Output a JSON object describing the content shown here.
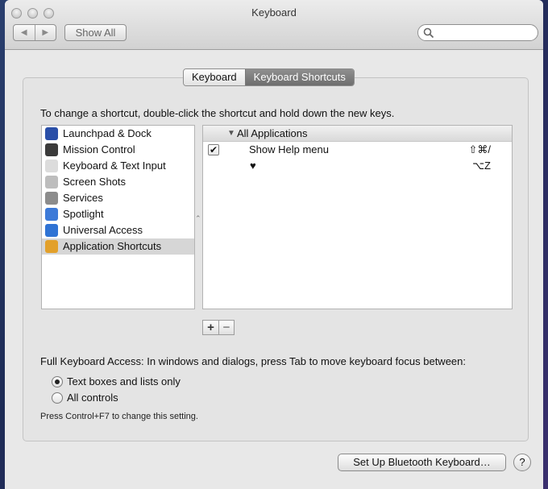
{
  "window": {
    "title": "Keyboard"
  },
  "toolbar": {
    "back_icon": "◀",
    "forward_icon": "▶",
    "show_all_label": "Show All",
    "search_value": "",
    "search_placeholder": ""
  },
  "tabs": [
    {
      "label": "Keyboard",
      "active": false
    },
    {
      "label": "Keyboard Shortcuts",
      "active": true
    }
  ],
  "instructions": "To change a shortcut, double-click the shortcut and hold down the new keys.",
  "categories": [
    {
      "label": "Launchpad & Dock",
      "icon": "launchpad-dock-icon",
      "color": "#2a4fa8",
      "selected": false
    },
    {
      "label": "Mission Control",
      "icon": "mission-control-icon",
      "color": "#3b3b3b",
      "selected": false
    },
    {
      "label": "Keyboard & Text Input",
      "icon": "keyboard-icon",
      "color": "#dcdcdc",
      "selected": false
    },
    {
      "label": "Screen Shots",
      "icon": "screenshot-icon",
      "color": "#bdbdbd",
      "selected": false
    },
    {
      "label": "Services",
      "icon": "gear-icon",
      "color": "#8c8c8c",
      "selected": false
    },
    {
      "label": "Spotlight",
      "icon": "spotlight-icon",
      "color": "#3d7ad8",
      "selected": false
    },
    {
      "label": "Universal Access",
      "icon": "universal-access-icon",
      "color": "#2f73d4",
      "selected": false
    },
    {
      "label": "Application Shortcuts",
      "icon": "app-shortcuts-icon",
      "color": "#e2a02b",
      "selected": true
    }
  ],
  "shortcuts": {
    "group_label": "All Applications",
    "rows": [
      {
        "checked": true,
        "name": "Show Help menu",
        "keys": "⇧⌘/"
      },
      {
        "checked": false,
        "name": "♥",
        "keys": "⌥Z"
      }
    ]
  },
  "add_label": "+",
  "remove_label": "−",
  "full_keyboard_access": {
    "label": "Full Keyboard Access: In windows and dialogs, press Tab to move keyboard focus between:",
    "options": [
      {
        "label": "Text boxes and lists only",
        "selected": true
      },
      {
        "label": "All controls",
        "selected": false
      }
    ],
    "note": "Press Control+F7 to change this setting."
  },
  "bluetooth_button": "Set Up Bluetooth Keyboard…",
  "help_label": "?"
}
